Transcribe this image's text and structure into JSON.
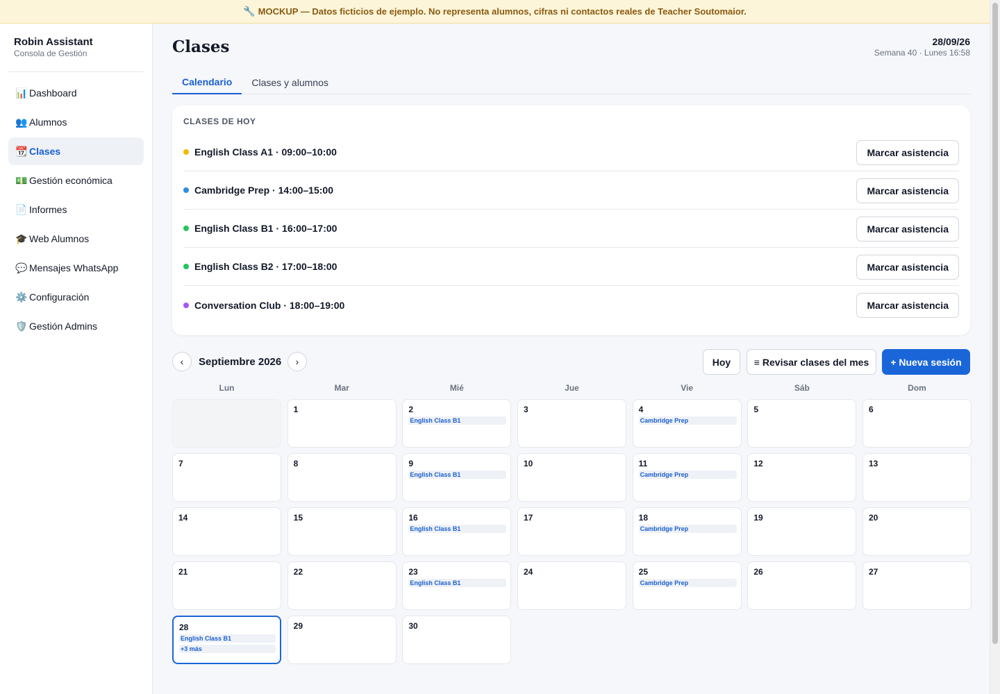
{
  "banner": {
    "icon": "wrench-icon",
    "text": "MOCKUP — Datos ficticios de ejemplo. No representa alumnos, cifras ni contactos reales de Teacher Soutomaior."
  },
  "brand": {
    "title": "Robin Assistant",
    "subtitle": "Consola de Gestión"
  },
  "sidebar": {
    "items": [
      {
        "icon": "📊",
        "icon_name": "chart-icon",
        "label": "Dashboard",
        "active": false
      },
      {
        "icon": "👥",
        "icon_name": "users-icon",
        "label": "Alumnos",
        "active": false
      },
      {
        "icon": "📆",
        "icon_name": "calendar-icon",
        "label": "Clases",
        "active": true
      },
      {
        "icon": "💵",
        "icon_name": "money-icon",
        "label": "Gestión económica",
        "active": false
      },
      {
        "icon": "📄",
        "icon_name": "document-icon",
        "label": "Informes",
        "active": false
      },
      {
        "icon": "🎓",
        "icon_name": "graduation-cap-icon",
        "label": "Web Alumnos",
        "active": false
      },
      {
        "icon": "💬",
        "icon_name": "chat-bubble-icon",
        "label": "Mensajes WhatsApp",
        "active": false
      },
      {
        "icon": "⚙️",
        "icon_name": "gear-icon",
        "label": "Configuración",
        "active": false
      },
      {
        "icon": "🛡️",
        "icon_name": "shield-icon",
        "label": "Gestión Admins",
        "active": false
      }
    ]
  },
  "header": {
    "title": "Clases",
    "date": "28/09/26",
    "week_info": "Semana 40 · Lunes 16:58"
  },
  "tabs": [
    {
      "label": "Calendario",
      "active": true
    },
    {
      "label": "Clases y alumnos",
      "active": false
    }
  ],
  "today": {
    "heading": "CLASES DE HOY",
    "button_label": "Marcar asistencia",
    "classes": [
      {
        "label": "English Class A1 · 09:00–10:00",
        "color": "#f5b800"
      },
      {
        "label": "Cambridge Prep · 14:00–15:00",
        "color": "#2d8fe0"
      },
      {
        "label": "English Class B1 · 16:00–17:00",
        "color": "#22c55e"
      },
      {
        "label": "English Class B2 · 17:00–18:00",
        "color": "#22c55e"
      },
      {
        "label": "Conversation Club · 18:00–19:00",
        "color": "#a855f7"
      }
    ]
  },
  "calendar": {
    "month_label": "Septiembre 2026",
    "prev_icon": "‹",
    "next_icon": "›",
    "today_button": "Hoy",
    "review_icon": "≡",
    "review_button": "Revisar clases del mes",
    "new_session_button": "+ Nueva sesión",
    "weekdays": [
      "Lun",
      "Mar",
      "Mié",
      "Jue",
      "Vie",
      "Sáb",
      "Dom"
    ],
    "start_offset": 1,
    "today_day": 28,
    "days": [
      {
        "day": "1",
        "events": []
      },
      {
        "day": "2",
        "events": [
          "English Class B1"
        ]
      },
      {
        "day": "3",
        "events": []
      },
      {
        "day": "4",
        "events": [
          "Cambridge Prep"
        ]
      },
      {
        "day": "5",
        "events": []
      },
      {
        "day": "6",
        "events": []
      },
      {
        "day": "7",
        "events": []
      },
      {
        "day": "8",
        "events": []
      },
      {
        "day": "9",
        "events": [
          "English Class B1"
        ]
      },
      {
        "day": "10",
        "events": []
      },
      {
        "day": "11",
        "events": [
          "Cambridge Prep"
        ]
      },
      {
        "day": "12",
        "events": []
      },
      {
        "day": "13",
        "events": []
      },
      {
        "day": "14",
        "events": []
      },
      {
        "day": "15",
        "events": []
      },
      {
        "day": "16",
        "events": [
          "English Class B1"
        ]
      },
      {
        "day": "17",
        "events": []
      },
      {
        "day": "18",
        "events": [
          "Cambridge Prep"
        ]
      },
      {
        "day": "19",
        "events": []
      },
      {
        "day": "20",
        "events": []
      },
      {
        "day": "21",
        "events": []
      },
      {
        "day": "22",
        "events": []
      },
      {
        "day": "23",
        "events": [
          "English Class B1"
        ]
      },
      {
        "day": "24",
        "events": []
      },
      {
        "day": "25",
        "events": [
          "Cambridge Prep"
        ]
      },
      {
        "day": "26",
        "events": []
      },
      {
        "day": "27",
        "events": []
      },
      {
        "day": "28",
        "events": [
          "English Class B1",
          "+3 más"
        ]
      },
      {
        "day": "29",
        "events": []
      },
      {
        "day": "30",
        "events": []
      }
    ]
  }
}
